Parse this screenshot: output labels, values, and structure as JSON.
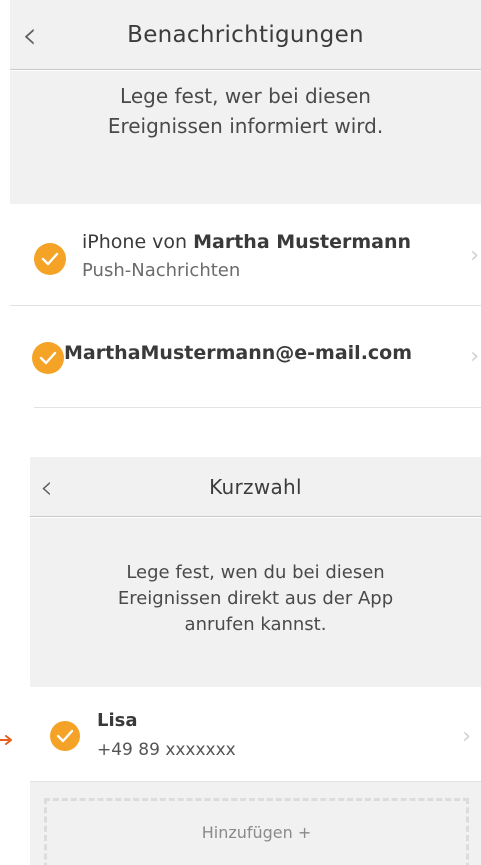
{
  "notifications": {
    "title": "Benachrichtigungen",
    "back_icon": "chevron-left-icon",
    "description": "Lege fest, wer bei diesen Ereignissen informiert wird.",
    "rows": [
      {
        "prefix": "iPhone von ",
        "name": "Martha  Mustermann",
        "sub": "Push-Nachrichten",
        "checked": true
      },
      {
        "prefix": "",
        "name": "MarthaMustermann@e-mail.com",
        "sub": "",
        "checked": true
      }
    ]
  },
  "speed_dial": {
    "title": "Kurzwahl",
    "back_icon": "chevron-left-icon",
    "description": "Lege fest, wen du bei diesen Ereignissen direkt aus der App anrufen kannst.",
    "contacts": [
      {
        "name": "Lisa",
        "phone": "+49 89 xxxxxxx",
        "checked": true
      }
    ],
    "add_label": "Hinzufügen +"
  },
  "colors": {
    "accent": "#f5a326",
    "arrow": "#e8601c",
    "background": "#f1f1f1"
  }
}
